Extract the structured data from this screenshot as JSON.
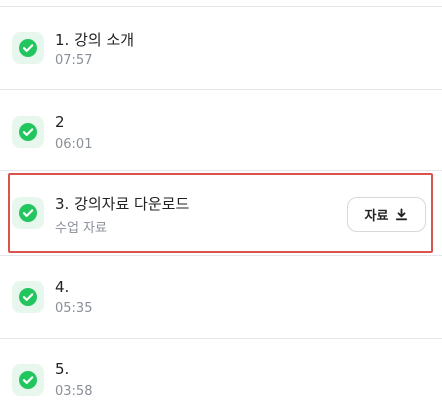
{
  "lessons": [
    {
      "title": "1. 강의 소개",
      "subtitle": "07:57",
      "completed": true
    },
    {
      "title": "2",
      "subtitle": "06:01",
      "completed": true
    },
    {
      "title": "3. 강의자료 다운로드",
      "subtitle": "수업 자료",
      "completed": true,
      "button_label": "자료"
    },
    {
      "title": "4.",
      "subtitle": "05:35",
      "completed": true
    },
    {
      "title": "5.",
      "subtitle": "03:58",
      "completed": true
    }
  ],
  "colors": {
    "check": "#22c55e",
    "check_bg": "#e8f7ee",
    "highlight": "#d9534f"
  },
  "icons": {
    "status": "check-circle-icon",
    "download": "download-icon"
  }
}
